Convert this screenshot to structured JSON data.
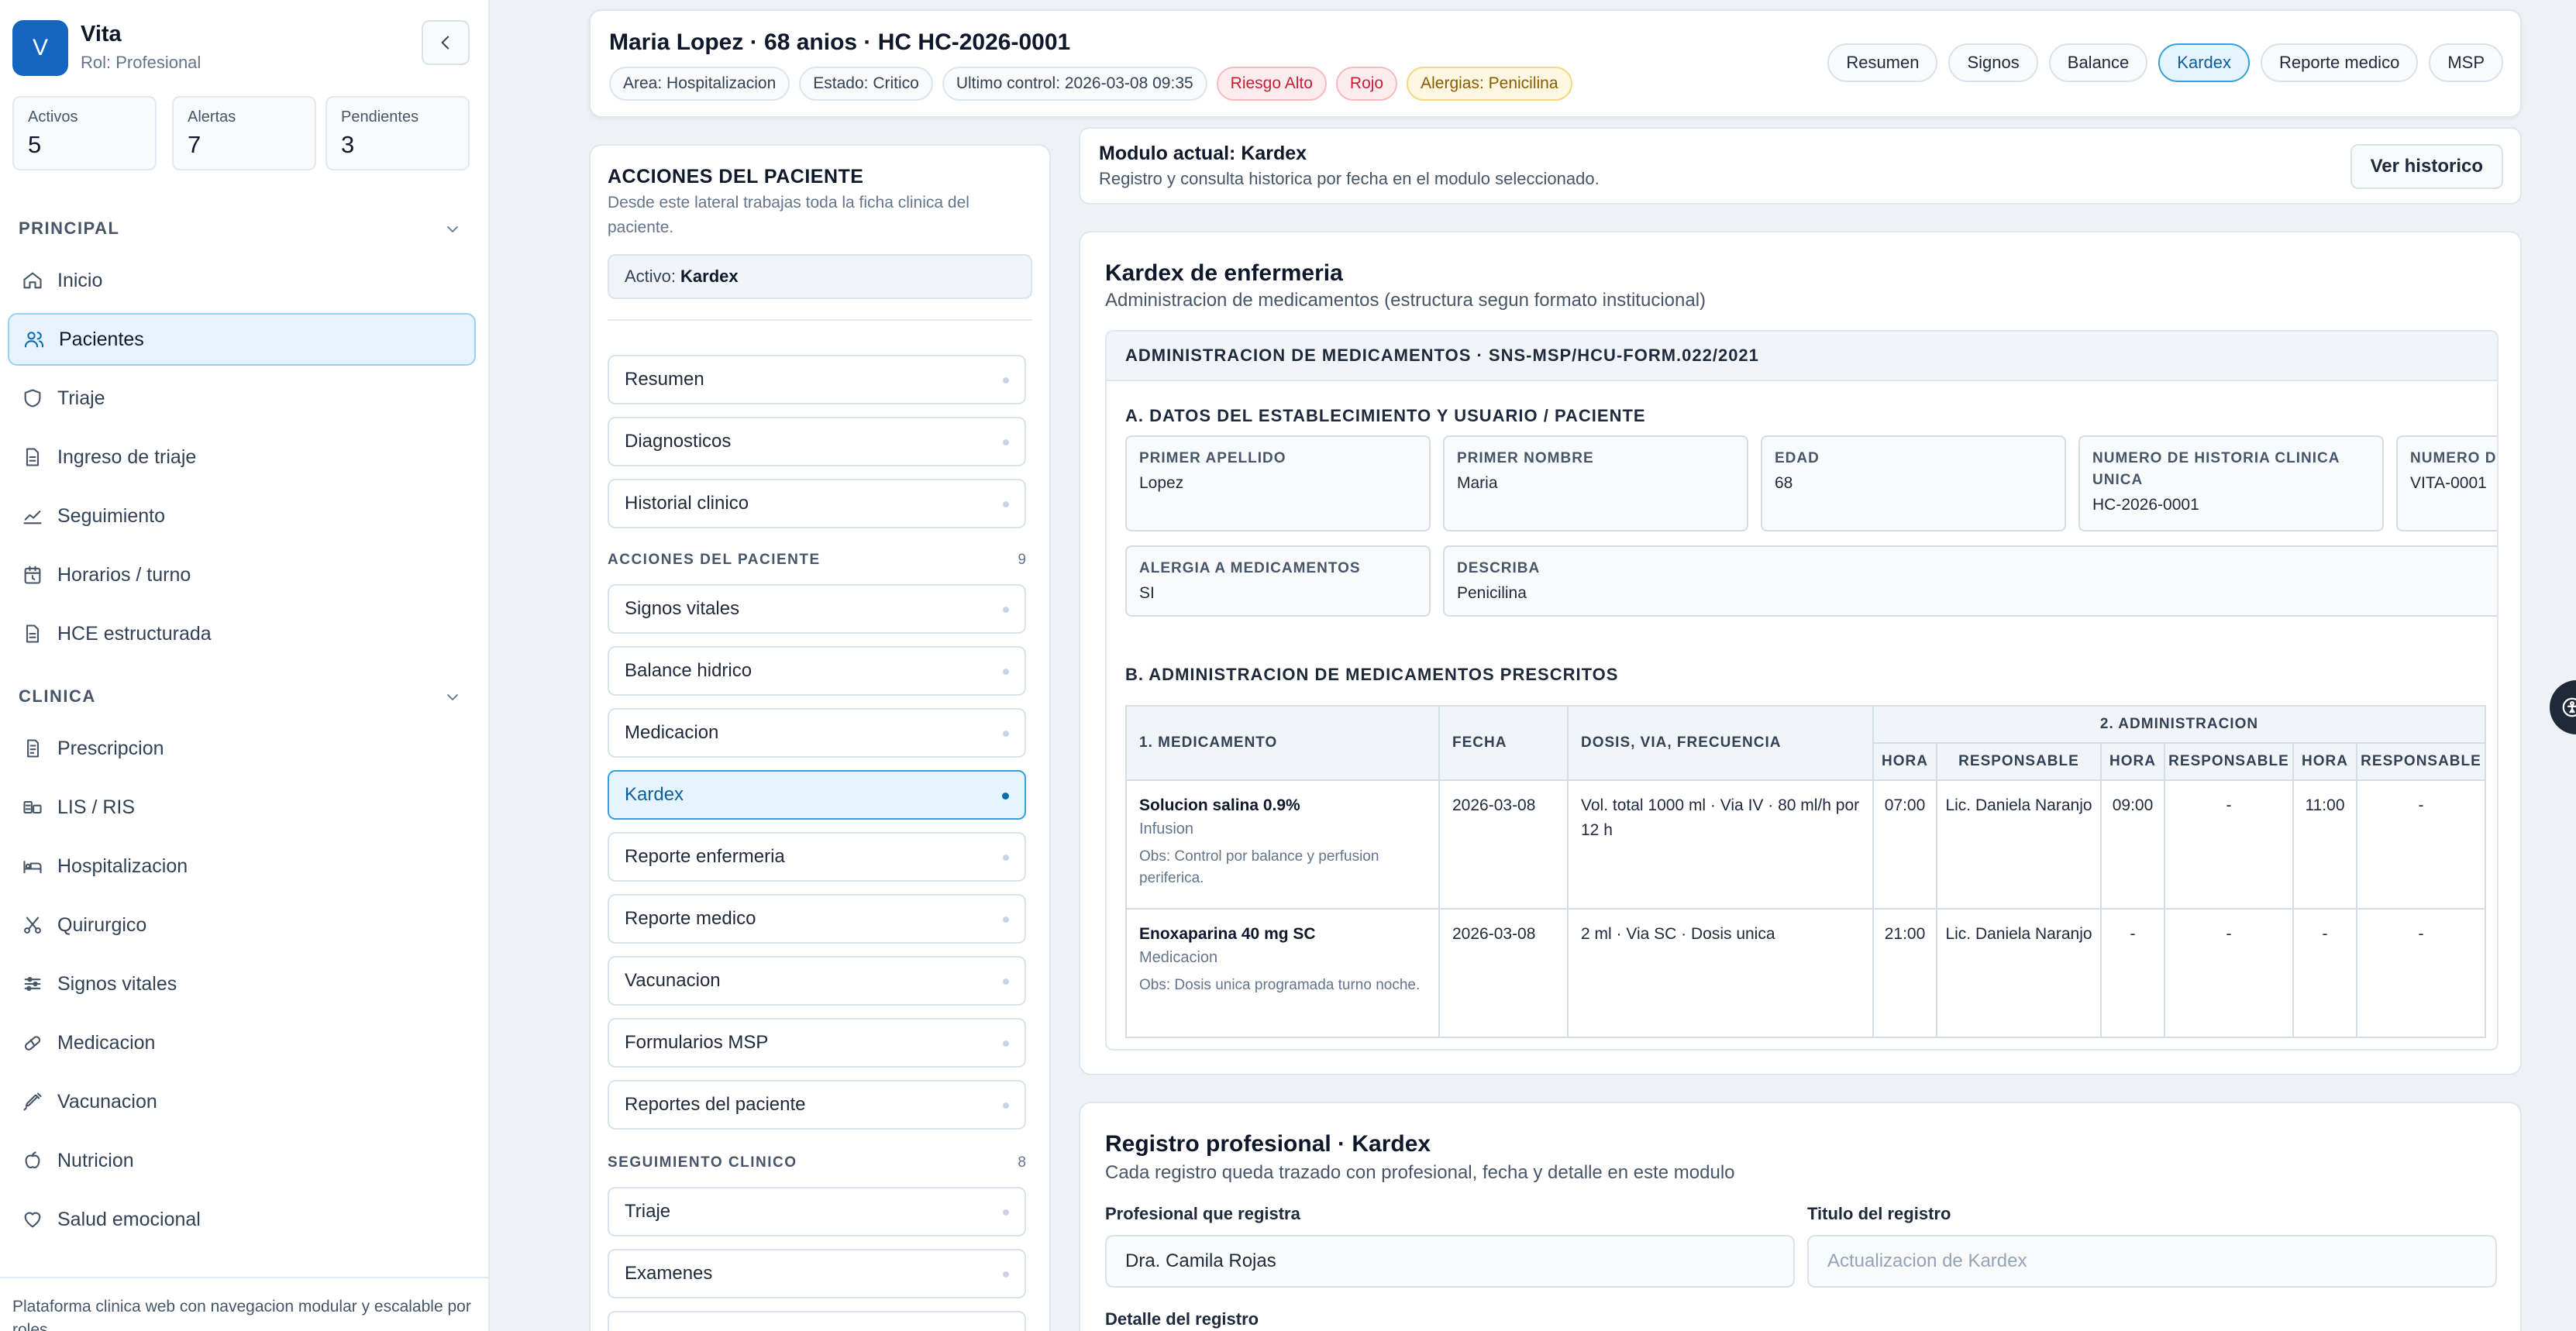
{
  "sidebar": {
    "brand_initial": "V",
    "brand_name": "Vita",
    "role": "Rol: Profesional",
    "stats": [
      {
        "label": "Activos",
        "value": "5"
      },
      {
        "label": "Alertas",
        "value": "7"
      },
      {
        "label": "Pendientes",
        "value": "3"
      }
    ],
    "sections": [
      {
        "title": "PRINCIPAL",
        "items": [
          {
            "label": "Inicio",
            "icon": "home-icon"
          },
          {
            "label": "Pacientes",
            "icon": "users-icon",
            "active": true
          },
          {
            "label": "Triaje",
            "icon": "shield-icon"
          },
          {
            "label": "Ingreso de triaje",
            "icon": "document-icon"
          },
          {
            "label": "Seguimiento",
            "icon": "trend-icon"
          },
          {
            "label": "Horarios / turno",
            "icon": "calendar-icon"
          },
          {
            "label": "HCE estructurada",
            "icon": "document-icon"
          }
        ]
      },
      {
        "title": "CLINICA",
        "items": [
          {
            "label": "Prescripcion",
            "icon": "prescription-icon"
          },
          {
            "label": "LIS / RIS",
            "icon": "lab-icon"
          },
          {
            "label": "Hospitalizacion",
            "icon": "bed-icon"
          },
          {
            "label": "Quirurgico",
            "icon": "scissors-icon"
          },
          {
            "label": "Signos vitales",
            "icon": "sliders-icon"
          },
          {
            "label": "Medicacion",
            "icon": "pill-icon"
          },
          {
            "label": "Vacunacion",
            "icon": "syringe-icon"
          },
          {
            "label": "Nutricion",
            "icon": "apple-icon"
          },
          {
            "label": "Salud emocional",
            "icon": "heart-icon"
          }
        ]
      }
    ],
    "footer": "Plataforma clinica web con navegacion modular y escalable por roles."
  },
  "header": {
    "title": "Maria Lopez · 68 anios · HC HC-2026-0001",
    "chips": [
      {
        "text": "Area: Hospitalizacion",
        "tone": "neutral"
      },
      {
        "text": "Estado: Critico",
        "tone": "neutral"
      },
      {
        "text": "Ultimo control: 2026-03-08 09:35",
        "tone": "neutral"
      },
      {
        "text": "Riesgo Alto",
        "tone": "red"
      },
      {
        "text": "Rojo",
        "tone": "red"
      },
      {
        "text": "Alergias: Penicilina",
        "tone": "yellow"
      }
    ],
    "tabs": [
      "Resumen",
      "Signos",
      "Balance",
      "Kardex",
      "Reporte medico",
      "MSP"
    ],
    "active_tab": "Kardex"
  },
  "actions": {
    "title": "ACCIONES DEL PACIENTE",
    "description": "Desde este lateral trabajas toda la ficha clinica del paciente.",
    "active_label": "Activo:",
    "active_value": "Kardex",
    "top_items": [
      "Resumen",
      "Diagnosticos",
      "Historial clinico"
    ],
    "groups": [
      {
        "title": "ACCIONES DEL PACIENTE",
        "count": "9",
        "items": [
          "Signos vitales",
          "Balance hidrico",
          "Medicacion",
          "Kardex",
          "Reporte enfermeria",
          "Reporte medico",
          "Vacunacion",
          "Formularios MSP",
          "Reportes del paciente"
        ]
      },
      {
        "title": "SEGUIMIENTO CLINICO",
        "count": "8",
        "items": [
          "Triaje",
          "Examenes",
          ""
        ]
      }
    ]
  },
  "module": {
    "title": "Modulo actual: Kardex",
    "description": "Registro y consulta historica por fecha en el modulo seleccionado.",
    "history_button": "Ver historico"
  },
  "kardex": {
    "title": "Kardex de enfermeria",
    "subtitle": "Administracion de medicamentos (estructura segun formato institucional)",
    "form_header": "ADMINISTRACION DE MEDICAMENTOS · SNS-MSP/HCU-FORM.022/2021",
    "section_a": "A. DATOS DEL ESTABLECIMIENTO Y USUARIO / PACIENTE",
    "fields": [
      {
        "label": "PRIMER APELLIDO",
        "value": "Lopez"
      },
      {
        "label": "PRIMER NOMBRE",
        "value": "Maria"
      },
      {
        "label": "EDAD",
        "value": "68"
      },
      {
        "label": "NUMERO DE HISTORIA CLINICA UNICA",
        "value": "HC-2026-0001"
      },
      {
        "label": "NUMERO DE ARCHIVO",
        "value": "VITA-0001"
      }
    ],
    "allergy": {
      "label": "ALERGIA A MEDICAMENTOS",
      "value": "SI"
    },
    "describe": {
      "label": "DESCRIBA",
      "value": "Penicilina"
    },
    "section_b": "B. ADMINISTRACION DE MEDICAMENTOS PRESCRITOS",
    "table": {
      "col_medicamento": "1. MEDICAMENTO",
      "col_fecha": "FECHA",
      "col_dosis": "DOSIS, VIA, FRECUENCIA",
      "col_admin": "2. ADMINISTRACION",
      "sub_hora": "HORA",
      "sub_resp": "RESPONSABLE",
      "rows": [
        {
          "name": "Solucion salina 0.9%",
          "kind": "Infusion",
          "obs": "Obs: Control por balance y perfusion periferica.",
          "date": "2026-03-08",
          "dose": "Vol. total 1000 ml · Via IV · 80 ml/h por 12 h",
          "admin": [
            [
              "07:00",
              "Lic. Daniela Naranjo"
            ],
            [
              "09:00",
              "-"
            ],
            [
              "11:00",
              "-"
            ]
          ]
        },
        {
          "name": "Enoxaparina 40 mg SC",
          "kind": "Medicacion",
          "obs": "Obs: Dosis unica programada turno noche.",
          "date": "2026-03-08",
          "dose": "2 ml · Via SC · Dosis unica",
          "admin": [
            [
              "21:00",
              "Lic. Daniela Naranjo"
            ],
            [
              "-",
              "-"
            ],
            [
              "-",
              "-"
            ]
          ]
        }
      ]
    }
  },
  "registro": {
    "title": "Registro profesional · Kardex",
    "subtitle": "Cada registro queda trazado con profesional, fecha y detalle en este modulo",
    "professional_label": "Profesional que registra",
    "professional_value": "Dra. Camila Rojas",
    "title_label": "Titulo del registro",
    "title_placeholder": "Actualizacion de Kardex",
    "detail_label": "Detalle del registro"
  },
  "floating_button_icon": "accessibility-icon"
}
